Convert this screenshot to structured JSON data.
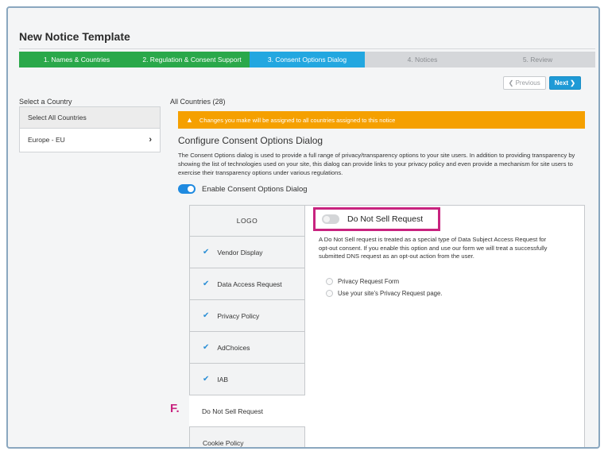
{
  "page": {
    "title": "New Notice Template"
  },
  "steps": [
    {
      "label": "1. Names & Countries",
      "state": "done"
    },
    {
      "label": "2. Regulation & Consent Support",
      "state": "done"
    },
    {
      "label": "3. Consent Options Dialog",
      "state": "active"
    },
    {
      "label": "4. Notices",
      "state": "todo"
    },
    {
      "label": "5. Review",
      "state": "todo"
    }
  ],
  "nav": {
    "previous_label": "Previous",
    "next_label": "Next"
  },
  "left": {
    "heading": "Select a Country",
    "select_all": "Select All Countries",
    "country": "Europe - EU"
  },
  "main": {
    "heading": "All Countries (28)",
    "warning": "Changes you make will be assigned to all countries assigned to this notice",
    "section_title": "Configure Consent Options Dialog",
    "description": "The Consent Options dialog is used to provide a full range of privacy/transparency options to your site users. In addition to providing transparency by showing the list of technologies used on your site, this dialog can provide links to your privacy policy and even provide a mechanism for site users to exercise their transparency options under various regulations.",
    "enable_label": "Enable Consent Options Dialog"
  },
  "menu": [
    {
      "label": "LOGO",
      "checked": false
    },
    {
      "label": "Vendor Display",
      "checked": true
    },
    {
      "label": "Data Access Request",
      "checked": true
    },
    {
      "label": "Privacy Policy",
      "checked": true
    },
    {
      "label": "AdChoices",
      "checked": true
    },
    {
      "label": "IAB",
      "checked": true
    },
    {
      "label": "Do Not Sell Request",
      "checked": false
    },
    {
      "label": "Cookie Policy",
      "checked": false
    }
  ],
  "panel": {
    "title": "Do Not Sell Request",
    "description": "A Do Not Sell request is treated as a special type of Data Subject Access Request for opt-out consent. If you enable this option and use our form we will treat a successfully submitted DNS request as an opt-out action from the user.",
    "option_form": "Privacy Request Form",
    "option_page": "Use your site's Privacy Request page."
  },
  "annotation": {
    "marker": "F."
  },
  "colors": {
    "accent": "#23a7e0",
    "done": "#2aa84a",
    "warning": "#f5a000",
    "highlight": "#c8237f"
  }
}
